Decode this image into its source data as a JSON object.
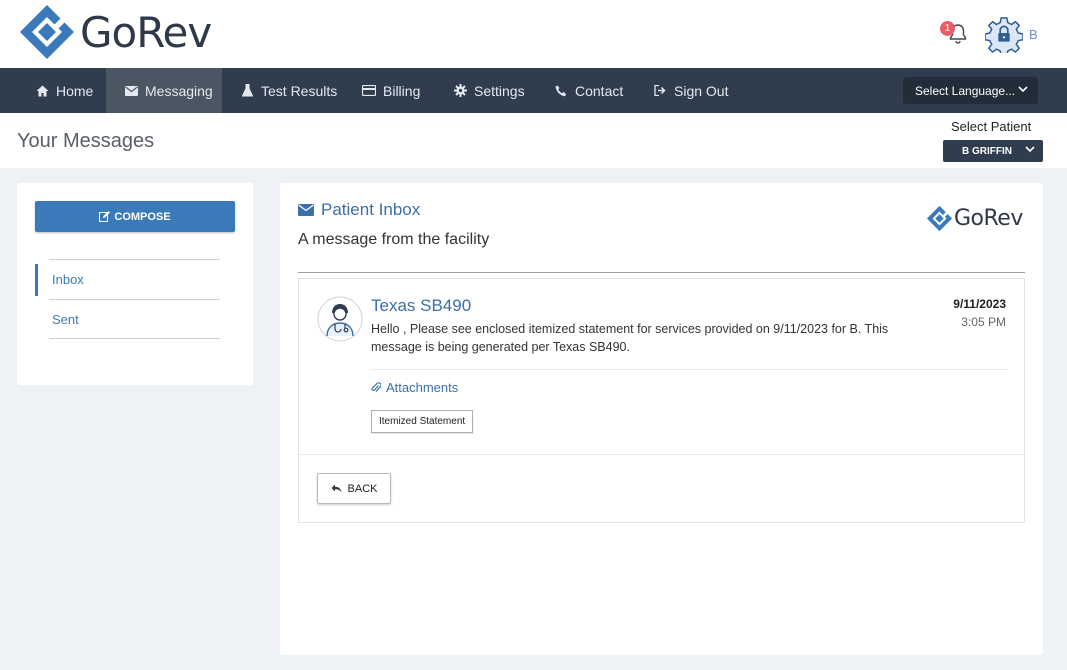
{
  "app": {
    "logo_text": "GoRev"
  },
  "header": {
    "notification_count": "1",
    "user_initial": "B"
  },
  "nav": {
    "items": [
      {
        "label": "Home",
        "icon": "home-icon"
      },
      {
        "label": "Messaging",
        "icon": "envelope-icon",
        "active": true
      },
      {
        "label": "Test Results",
        "icon": "flask-icon"
      },
      {
        "label": "Billing",
        "icon": "credit-card-icon"
      },
      {
        "label": "Settings",
        "icon": "gear-icon"
      },
      {
        "label": "Contact",
        "icon": "phone-icon"
      },
      {
        "label": "Sign Out",
        "icon": "sign-out-icon"
      }
    ],
    "language_select": "Select Language..."
  },
  "page": {
    "title": "Your Messages",
    "select_patient_label": "Select Patient",
    "patient_value": "B GRIFFIN"
  },
  "sidebar": {
    "compose_label": "COMPOSE",
    "items": [
      {
        "label": "Inbox",
        "active": true
      },
      {
        "label": "Sent"
      }
    ]
  },
  "main": {
    "title": "Patient Inbox",
    "subtitle": "A message from the facility",
    "logo_text": "GoRev",
    "message": {
      "subject": "Texas SB490",
      "body": "Hello , Please see enclosed itemized statement for services provided on 9/11/2023 for B. This message is being generated per Texas SB490.",
      "date": "9/11/2023",
      "time": "3:05 PM",
      "attachments_label": "Attachments",
      "attachment_name": "Itemized Statement"
    },
    "back_label": "BACK"
  },
  "colors": {
    "nav_bg": "#2f3d4f",
    "accent": "#3a7abb",
    "link": "#3a6fa8",
    "badge": "#ea5d67"
  }
}
